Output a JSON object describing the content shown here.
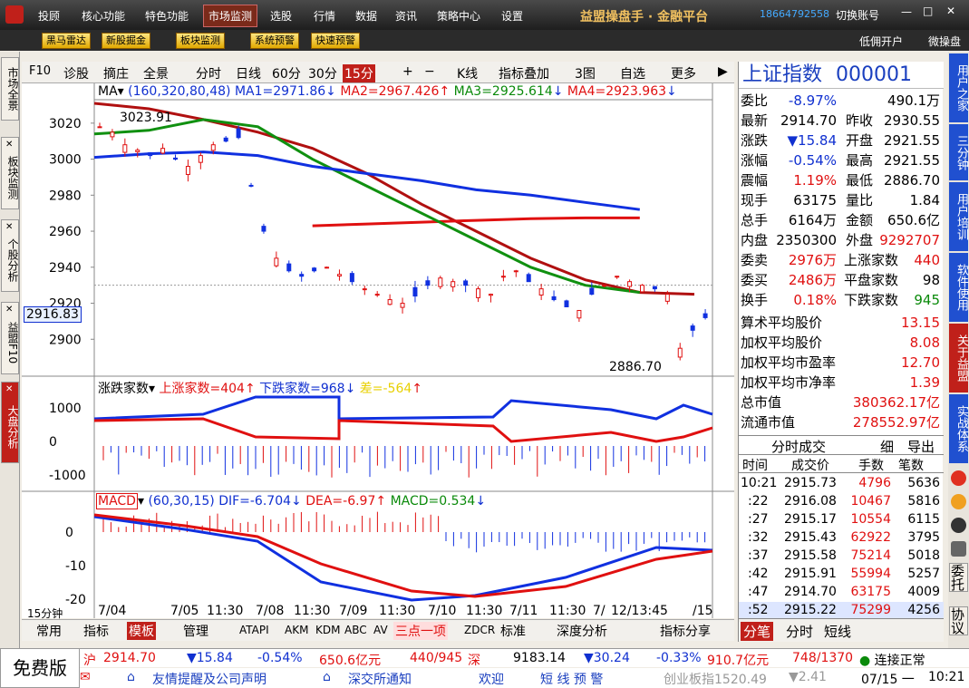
{
  "topbar": {
    "menu": [
      "投顾",
      "核心功能",
      "特色功能",
      "市场监测",
      "选股",
      "行情",
      "数据",
      "资讯",
      "策略中心",
      "设置"
    ],
    "active": "市场监测",
    "brand": "益盟操盘手 · 金融平台",
    "phone": "18664792558",
    "switch": "切换账号"
  },
  "toolbar": {
    "buttons": [
      "黑马雷达",
      "新股掘金",
      "板块监测",
      "系统预警",
      "快速预警"
    ],
    "right1": "低佣开户",
    "right2": "微操盘"
  },
  "left_tabs": [
    "市场全景",
    "板块监测",
    "个股分析",
    "益盟F10",
    "大盘分析"
  ],
  "chart_toolbar": [
    "F10",
    "诊股",
    "摘庄",
    "全景",
    "分时",
    "日线",
    "60分",
    "30分",
    "15分",
    "+",
    "−",
    "K线",
    "指标叠加",
    "3图",
    "自选",
    "更多"
  ],
  "ma_bar": {
    "name": "MA",
    "params": "(160,320,80,48)",
    "ma1": "MA1=2971.86",
    "ma2": "MA2=2967.426",
    "ma3": "MA3=2925.614",
    "ma4": "MA4=2923.963"
  },
  "adv_bar": {
    "name": "涨跌家数",
    "up": "上涨家数=404",
    "down": "下跌家数=968",
    "diff": "差=-564"
  },
  "macd_bar": {
    "name": "MACD",
    "params": "(60,30,15)",
    "dif": "DIF=-6.704",
    "dea": "DEA=-6.97",
    "macd": "MACD=0.534"
  },
  "price_labels": {
    "high": "3023.91",
    "low": "2886.70",
    "cursor": "2916.83"
  },
  "x_labels": [
    "7/04",
    "7/05",
    "11:30",
    "7/08",
    "11:30",
    "7/09",
    "11:30",
    "7/10",
    "11:30",
    "7/11",
    "11:30",
    "7/",
    "12/13:45",
    "/15"
  ],
  "period": "15分钟",
  "bottom_tabs": [
    "常用",
    "指标",
    "模板",
    "管理",
    "ATAPI",
    "AKM",
    "KDM",
    "ABC",
    "AV",
    "三点一项",
    "ZDCR",
    "标准",
    "深度分析",
    "指标分享"
  ],
  "right_panel": {
    "title": "上证指数",
    "code": "000001",
    "rows": [
      [
        "委比",
        "-8.97%",
        "",
        "490.1万"
      ],
      [
        "最新",
        "2914.70",
        "昨收",
        "2930.55"
      ],
      [
        "涨跌",
        "▼15.84",
        "开盘",
        "2921.55"
      ],
      [
        "涨幅",
        "-0.54%",
        "最高",
        "2921.55"
      ],
      [
        "震幅",
        "1.19%",
        "最低",
        "2886.70"
      ],
      [
        "现手",
        "63175",
        "量比",
        "1.84"
      ],
      [
        "总手",
        "6164万",
        "金额",
        "650.6亿"
      ],
      [
        "内盘",
        "2350300",
        "外盘",
        "9292707"
      ]
    ],
    "rows2": [
      [
        "委卖",
        "2976万",
        "上涨家数",
        "440"
      ],
      [
        "委买",
        "2486万",
        "平盘家数",
        "98"
      ],
      [
        "换手",
        "0.18%",
        "下跌家数",
        "945"
      ]
    ],
    "rows3": [
      [
        "算术平均股价",
        "13.15"
      ],
      [
        "加权平均股价",
        "8.08"
      ],
      [
        "加权平均市盈率",
        "12.70"
      ],
      [
        "加权平均市净率",
        "1.39"
      ],
      [
        "总市值",
        "380362.17亿"
      ],
      [
        "流通市值",
        "278552.97亿"
      ]
    ],
    "trade_tabs": [
      "分时成交",
      "细",
      "导出"
    ],
    "trade_header": [
      "时间",
      "成交价",
      "手数",
      "笔数"
    ],
    "trades": [
      [
        "10:21",
        "2915.73",
        "4796",
        "5636"
      ],
      [
        ":22",
        "2916.08",
        "10467",
        "5816"
      ],
      [
        ":27",
        "2915.17",
        "10554",
        "6115"
      ],
      [
        ":32",
        "2915.43",
        "62922",
        "3795"
      ],
      [
        ":37",
        "2915.58",
        "75214",
        "5018"
      ],
      [
        ":42",
        "2915.91",
        "55994",
        "5257"
      ],
      [
        ":47",
        "2914.70",
        "63175",
        "4009"
      ],
      [
        ":52",
        "2915.22",
        "75299",
        "4256"
      ]
    ],
    "bottom_tabs": [
      "分笔",
      "分时",
      "短线"
    ]
  },
  "right_tabs": [
    "用户之家",
    "三分钟",
    "用户培训",
    "软件使用",
    "关于益盟",
    "实战体系"
  ],
  "right_icons": [
    "委托",
    "协议"
  ],
  "status": {
    "free": "免费版",
    "sh_label": "沪",
    "sh_price": "2914.70",
    "sh_chg": "▼15.84",
    "sh_pct": "-0.54%",
    "sh_amt": "650.6亿元",
    "sh_ud": "440/945",
    "sz_label": "深",
    "sz_price": "9183.14",
    "sz_chg": "▼30.24",
    "sz_pct": "-0.33%",
    "sz_amt": "910.7亿元",
    "sz_ud": "748/1370",
    "conn": "连接正常",
    "notice1": "友情提醒及公司声明",
    "notice2": "深交所通知",
    "welcome": "欢迎",
    "alert": "短 线 预 警",
    "cyb": "创业板指1520.49",
    "cyb_chg": "▼2.41",
    "date": "07/15 一",
    "time": "10:21"
  },
  "chart_data": {
    "type": "candlestick",
    "y_ticks": [
      3020,
      3000,
      2980,
      2960,
      2940,
      2920,
      2900
    ],
    "ylim": [
      2880,
      3031
    ],
    "series": [
      {
        "name": "MA1",
        "color": "#b01010",
        "values": [
          3031,
          3028,
          3022,
          3015,
          3006,
          2992,
          2975,
          2960,
          2945,
          2933,
          2926,
          2925
        ]
      },
      {
        "name": "MA2",
        "color": "#e01010",
        "values": [
          null,
          null,
          null,
          null,
          2963,
          2964,
          2965,
          2966,
          2967,
          2967.4,
          2967.4
        ]
      },
      {
        "name": "MA3",
        "color": "#109010",
        "values": [
          3014,
          3016,
          3022,
          3018,
          3000,
          2985,
          2970,
          2955,
          2940,
          2930,
          2926
        ]
      },
      {
        "name": "MA4",
        "color": "#1030e0",
        "values": [
          3001,
          3003,
          3004,
          3002,
          2996,
          2992,
          2988,
          2983,
          2980,
          2976,
          2972
        ]
      }
    ],
    "adv_ticks": [
      1000,
      0,
      -1000
    ],
    "macd_ticks": [
      0,
      -10,
      -20
    ]
  }
}
